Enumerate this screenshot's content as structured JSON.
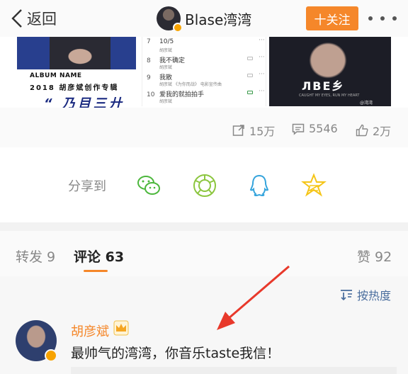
{
  "header": {
    "back_label": "返回",
    "user_name": "Blase湾湾",
    "follow_label": "十关注"
  },
  "album_left": {
    "album_name": "ALBUM NAME",
    "subtitle": "2018 胡彦斌创作专辑",
    "big_title": "“ 乃目三廾 ”"
  },
  "tracklist": [
    {
      "num": "7",
      "title": "10/5",
      "sub": "胡彦斌"
    },
    {
      "num": "8",
      "title": "我不确定",
      "sub": "胡彦斌"
    },
    {
      "num": "9",
      "title": "我散",
      "sub": "胡彦斌 《为你而战》 电影宣传曲"
    },
    {
      "num": "10",
      "title": "爱我的就拍拍手",
      "sub": "胡彦斌"
    }
  ],
  "album_right": {
    "logo": "ЛBE乡",
    "tag": "CAUGHT MY EYES, RUN MY HEART",
    "watermark": "@湾湾"
  },
  "stats": {
    "reposts": "15万",
    "comments": "5546",
    "likes": "2万"
  },
  "share": {
    "label": "分享到",
    "icons": [
      "wechat-icon",
      "moments-icon",
      "qq-icon",
      "qzone-icon"
    ]
  },
  "tabs": {
    "repost": "转发 9",
    "comment": "评论 63",
    "like": "赞 92"
  },
  "comments": {
    "sort_label": "按热度",
    "items": [
      {
        "author": "胡彦斌",
        "text": "最帅气的湾湾，你音乐taste我信！"
      }
    ]
  },
  "colors": {
    "accent": "#f5872a",
    "link": "#4a6e9e",
    "annotation_arrow": "#e8392b"
  }
}
